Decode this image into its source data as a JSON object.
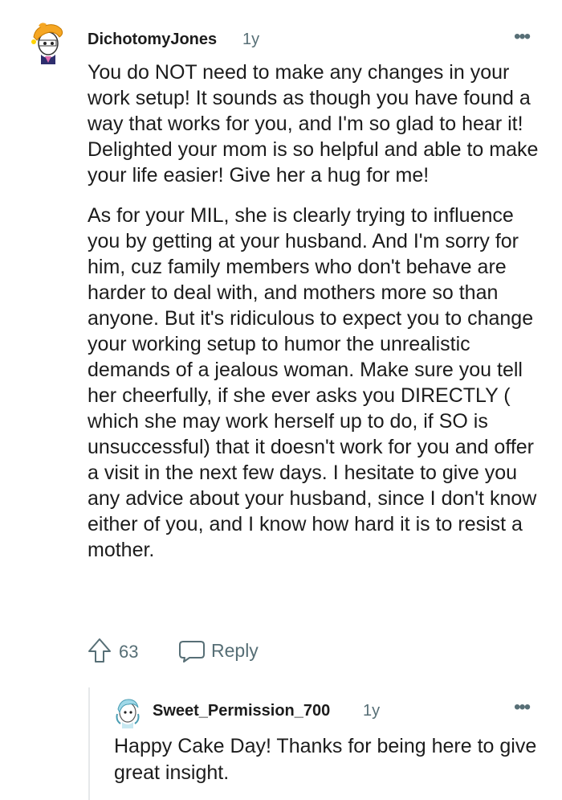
{
  "comment": {
    "author": "DichotomyJones",
    "age": "1y",
    "more": "•••",
    "paragraphs": [
      "You do NOT need to make any changes in your work setup! It sounds as though you have found a way that works for you, and I'm so glad to hear it! Delighted your mom is so helpful and able to make your life easier! Give her a hug for me!",
      "As for your MIL, she is clearly trying to influence you by getting at your husband. And I'm sorry for him, cuz family members who don't behave are harder to deal with, and mothers more so than anyone. But it's ridiculous to expect you to change your working setup to humor the unrealistic demands of a jealous woman. Make sure you tell her cheerfully, if she ever asks you DIRECTLY ( which she may work herself up to do, if SO is unsuccessful) that it doesn't work for you and offer a visit in the next few days. I hesitate to give you any advice about your husband, since I don't know either of you, and I know how hard it is to resist a mother."
    ],
    "votes": "63",
    "reply_label": "Reply"
  },
  "reply": {
    "author": "Sweet_Permission_700",
    "age": "1y",
    "more": "•••",
    "text": "Happy Cake Day! Thanks for being here to give great insight."
  },
  "icons": {
    "upvote": "upvote-arrow-icon",
    "reply": "speech-bubble-icon",
    "more": "more-options-icon"
  },
  "colors": {
    "meta": "#576f76",
    "text": "#1c1c1c",
    "thread_line": "#e6e8ea"
  }
}
